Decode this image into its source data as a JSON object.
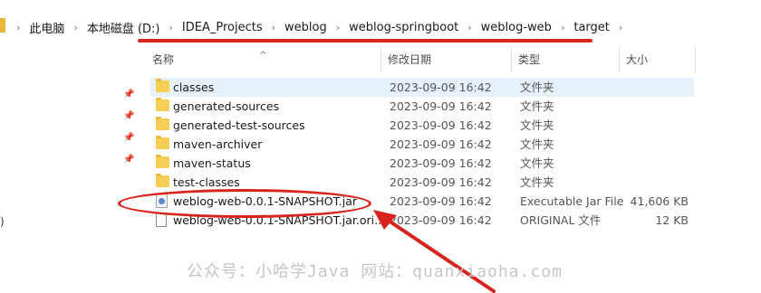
{
  "breadcrumb": {
    "items": [
      "此电脑",
      "本地磁盘 (D:)",
      "IDEA_Projects",
      "weblog",
      "weblog-springboot",
      "weblog-web",
      "target"
    ]
  },
  "columns": {
    "name": "名称",
    "date": "修改日期",
    "type": "类型",
    "size": "大小"
  },
  "files": [
    {
      "name": "classes",
      "date": "2023-09-09 16:42",
      "type": "文件夹",
      "size": "",
      "icon": "folder-icon"
    },
    {
      "name": "generated-sources",
      "date": "2023-09-09 16:42",
      "type": "文件夹",
      "size": "",
      "icon": "folder-icon"
    },
    {
      "name": "generated-test-sources",
      "date": "2023-09-09 16:42",
      "type": "文件夹",
      "size": "",
      "icon": "folder-icon"
    },
    {
      "name": "maven-archiver",
      "date": "2023-09-09 16:42",
      "type": "文件夹",
      "size": "",
      "icon": "folder-icon"
    },
    {
      "name": "maven-status",
      "date": "2023-09-09 16:42",
      "type": "文件夹",
      "size": "",
      "icon": "folder-icon"
    },
    {
      "name": "test-classes",
      "date": "2023-09-09 16:42",
      "type": "文件夹",
      "size": "",
      "icon": "folder-icon"
    },
    {
      "name": "weblog-web-0.0.1-SNAPSHOT.jar",
      "date": "2023-09-09 16:42",
      "type": "Executable Jar File",
      "size": "41,606 KB",
      "icon": "jar-icon"
    },
    {
      "name": "weblog-web-0.0.1-SNAPSHOT.jar.ori...",
      "date": "2023-09-09 16:42",
      "type": "ORIGINAL 文件",
      "size": "12 KB",
      "icon": "file-icon"
    }
  ],
  "leftnav": {
    "partial": ")"
  },
  "watermark": "公众号：小哈学Java 网站：quanxiaoha.com",
  "colors": {
    "annotation": "#d9241d",
    "selection": "#e6f1fb",
    "folder": "#f5cf55"
  }
}
